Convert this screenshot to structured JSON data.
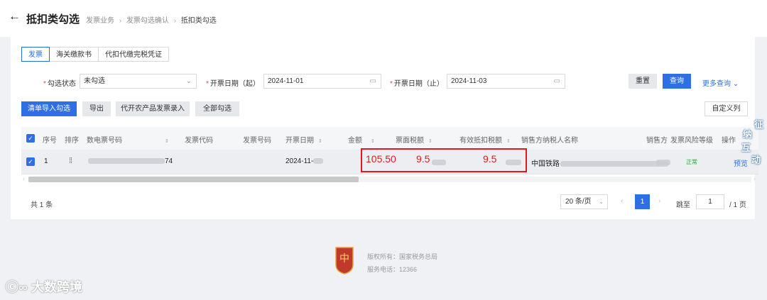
{
  "header": {
    "title": "抵扣类勾选",
    "breadcrumb": [
      "发票业务",
      "发票勾选确认",
      "抵扣类勾选"
    ]
  },
  "tabs": [
    {
      "label": "发票",
      "active": true
    },
    {
      "label": "海关缴款书",
      "active": false
    },
    {
      "label": "代扣代缴完税凭证",
      "active": false
    }
  ],
  "filters": {
    "status_label": "勾选状态",
    "status_value": "未勾选",
    "date_start_label": "开票日期（起）",
    "date_start_value": "2024-11-01",
    "date_end_label": "开票日期（止）",
    "date_end_value": "2024-11-03"
  },
  "buttons": {
    "reset": "重置",
    "query": "查询",
    "more_query": "更多查询",
    "import_select": "清单导入勾选",
    "export": "导出",
    "agri_entry": "代开农产品发票录入",
    "select_all": "全部勾选",
    "custom_columns": "自定义列"
  },
  "table": {
    "columns": [
      "序号",
      "排序",
      "数电票号码",
      "发票代码",
      "发票号码",
      "开票日期",
      "金额",
      "票面税额",
      "有效抵扣税额",
      "销售方纳税人名称",
      "销售方",
      "发票风险等级",
      "操作"
    ],
    "rows": [
      {
        "index": "1",
        "invoice_no_suffix": "74",
        "date": "2024-11-",
        "amount": "105.50",
        "tax": "9.5",
        "effective_tax": "9.5",
        "seller_prefix": "中国铁路",
        "risk": "正常",
        "action": "预览"
      }
    ]
  },
  "pagination": {
    "total": "共 1 条",
    "page_size": "20 条/页",
    "current_page": "1",
    "jump_label": "跳至",
    "jump_value": "1",
    "total_pages": "/ 1 页"
  },
  "footer": {
    "copyright": "版权所有：国家税务总局",
    "phone": "服务电话：12366"
  },
  "watermark": "大数跨境",
  "side_widget": [
    "征",
    "纳",
    "互",
    "动"
  ],
  "colors": {
    "primary": "#2f6fe4",
    "highlight": "#e01b1b",
    "risk_ok": "#2f9a4a"
  }
}
